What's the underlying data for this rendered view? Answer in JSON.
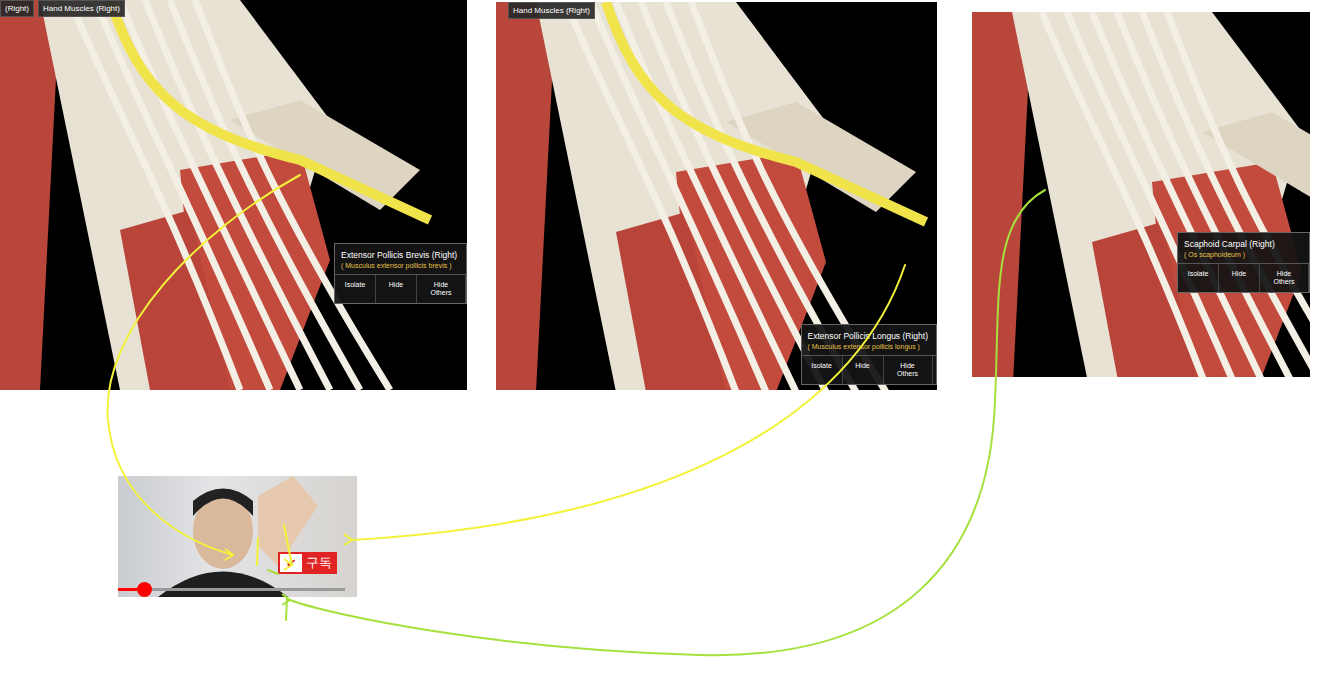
{
  "panels": [
    {
      "labels": [
        "(Right)",
        "Hand Muscles (Right)"
      ],
      "tooltip": {
        "title": "Extensor Pollicis Brevis (Right)",
        "latin": "( Musculus extensor pollicis brevis )",
        "buttons": [
          "Isolate",
          "Hide",
          "Hide Others"
        ]
      }
    },
    {
      "labels": [
        "Hand Muscles (Right)"
      ],
      "tooltip": {
        "title": "Extensor Pollicis Longus (Right)",
        "latin": "( Musculus extensor pollicis longus )",
        "buttons": [
          "Isolate",
          "Hide",
          "Hide Others"
        ]
      }
    },
    {
      "labels": [],
      "tooltip": {
        "title": "Scaphoid Carpal (Right)",
        "latin": "( Os scaphoideum )",
        "buttons": [
          "Isolate",
          "Hide",
          "Hide Others"
        ]
      }
    }
  ],
  "video": {
    "check": "✔",
    "subscribe": "구독",
    "progress": 0.12
  },
  "arrows": [
    {
      "color": "#f2f23a"
    },
    {
      "color": "#f2f23a"
    },
    {
      "color": "#a6e03c"
    },
    {
      "color": "#f2f23a"
    },
    {
      "color": "#f2f23a"
    },
    {
      "color": "#a6e03c"
    }
  ]
}
